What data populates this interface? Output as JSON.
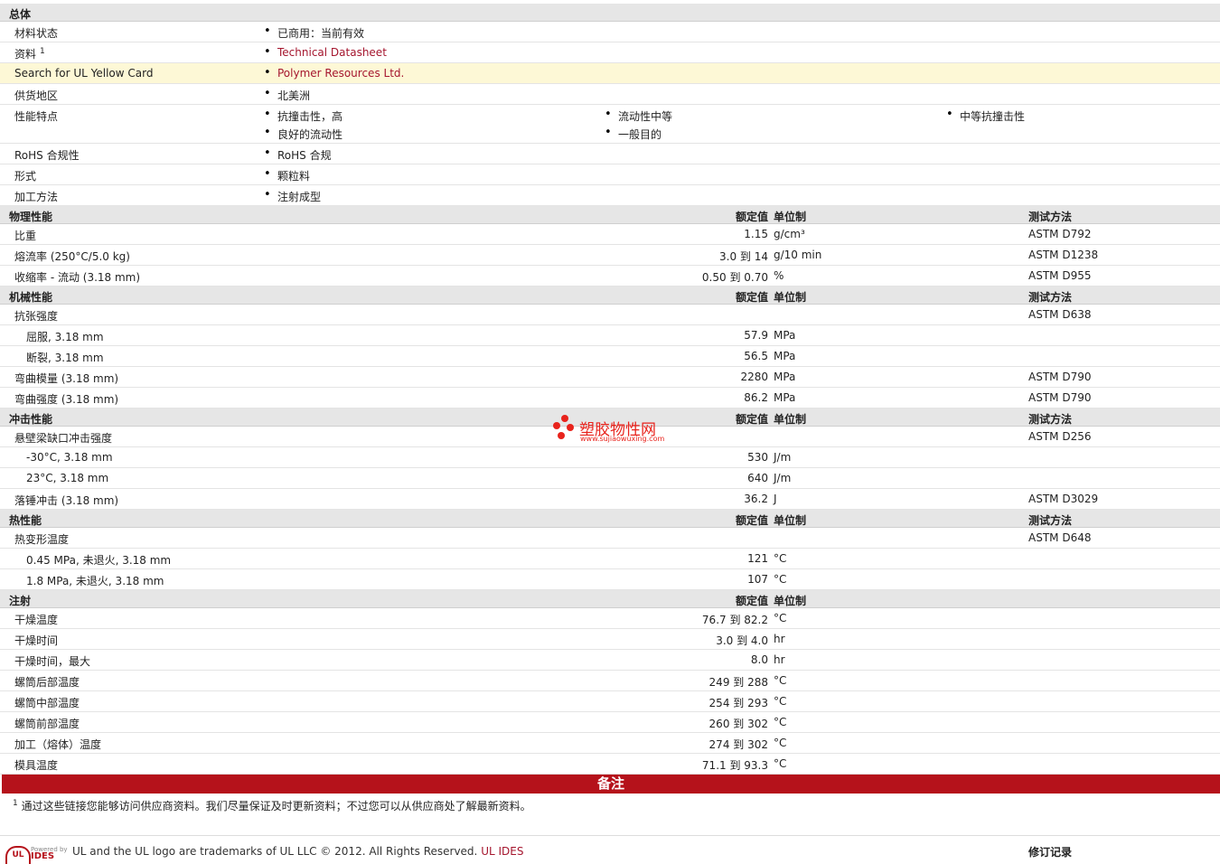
{
  "overview": {
    "title": "总体",
    "rows": [
      {
        "label": "材料状态",
        "bullets": [
          "已商用：当前有效"
        ]
      },
      {
        "label": "资料",
        "sup": "1",
        "bullets": [
          "Technical Datasheet"
        ],
        "link": true
      },
      {
        "label": "Search for UL Yellow Card",
        "bullets": [
          "Polymer Resources Ltd."
        ],
        "link": true,
        "highlight": true
      },
      {
        "label": "供货地区",
        "bullets": [
          "北美洲"
        ]
      },
      {
        "label": "性能特点",
        "cols": [
          [
            "抗撞击性，高",
            "良好的流动性"
          ],
          [
            "流动性中等",
            "一般目的"
          ],
          [
            "中等抗撞击性"
          ]
        ]
      },
      {
        "label": "RoHS 合规性",
        "bullets": [
          "RoHS 合规"
        ]
      },
      {
        "label": "形式",
        "bullets": [
          "颗粒料"
        ]
      },
      {
        "label": "加工方法",
        "bullets": [
          "注射成型"
        ]
      }
    ]
  },
  "headers": {
    "value": "额定值",
    "unit": "单位制",
    "method": "测试方法"
  },
  "sections": [
    {
      "title": "物理性能",
      "show_method": true,
      "rows": [
        {
          "label": "比重",
          "value": "1.15",
          "unit": "g/cm³",
          "method": "ASTM D792"
        },
        {
          "label": "熔流率  (250°C/5.0 kg)",
          "value": "3.0 到   14",
          "unit": "g/10 min",
          "method": "ASTM D1238"
        },
        {
          "label": "收缩率  - 流动  (3.18 mm)",
          "value": "0.50 到  0.70",
          "unit": "%",
          "method": "ASTM D955"
        }
      ]
    },
    {
      "title": "机械性能",
      "show_method": true,
      "rows": [
        {
          "label": "抗张强度",
          "value": "",
          "unit": "",
          "method": "ASTM D638"
        },
        {
          "label": "屈服, 3.18 mm",
          "sub": true,
          "value": "57.9",
          "unit": "MPa",
          "method": ""
        },
        {
          "label": "断裂, 3.18 mm",
          "sub": true,
          "value": "56.5",
          "unit": "MPa",
          "method": ""
        },
        {
          "label": "弯曲模量  (3.18 mm)",
          "value": "2280",
          "unit": "MPa",
          "method": "ASTM D790"
        },
        {
          "label": "弯曲强度  (3.18 mm)",
          "value": "86.2",
          "unit": "MPa",
          "method": "ASTM D790"
        }
      ]
    },
    {
      "title": "冲击性能",
      "show_method": true,
      "rows": [
        {
          "label": "悬壁梁缺口冲击强度",
          "value": "",
          "unit": "",
          "method": "ASTM D256"
        },
        {
          "label": "-30°C, 3.18 mm",
          "sub": true,
          "value": "530",
          "unit": "J/m",
          "method": ""
        },
        {
          "label": "23°C, 3.18 mm",
          "sub": true,
          "value": "640",
          "unit": "J/m",
          "method": ""
        },
        {
          "label": "落锤冲击  (3.18 mm)",
          "value": "36.2",
          "unit": "J",
          "method": "ASTM D3029"
        }
      ]
    },
    {
      "title": "热性能",
      "show_method": true,
      "rows": [
        {
          "label": "热变形温度",
          "value": "",
          "unit": "",
          "method": "ASTM D648"
        },
        {
          "label": "0.45 MPa, 未退火, 3.18 mm",
          "sub": true,
          "value": "121",
          "unit": "°C",
          "method": ""
        },
        {
          "label": "1.8 MPa, 未退火, 3.18 mm",
          "sub": true,
          "value": "107",
          "unit": "°C",
          "method": ""
        }
      ]
    },
    {
      "title": "注射",
      "show_method": false,
      "rows": [
        {
          "label": "干燥温度",
          "value": "76.7 到  82.2",
          "unit": "°C",
          "method": ""
        },
        {
          "label": "干燥时间",
          "value": "3.0 到   4.0",
          "unit": "hr",
          "method": ""
        },
        {
          "label": "干燥时间，最大",
          "value": "8.0",
          "unit": "hr",
          "method": ""
        },
        {
          "label": "螺筒后部温度",
          "value": "249 到  288",
          "unit": "°C",
          "method": ""
        },
        {
          "label": "螺筒中部温度",
          "value": "254 到  293",
          "unit": "°C",
          "method": ""
        },
        {
          "label": "螺筒前部温度",
          "value": "260 到  302",
          "unit": "°C",
          "method": ""
        },
        {
          "label": "加工（熔体）温度",
          "value": "274 到  302",
          "unit": "°C",
          "method": ""
        },
        {
          "label": "模具温度",
          "value": "71.1 到  93.3",
          "unit": "°C",
          "method": ""
        }
      ]
    }
  ],
  "notes": {
    "title": "备注",
    "footnote_num": "1",
    "footnote": "通过这些链接您能够访问供应商资料。我们尽量保证及时更新资料；不过您可以从供应商处了解最新资料。"
  },
  "footer": {
    "copyright": "UL and the UL logo are trademarks of UL LLC © 2012. All Rights Reserved.",
    "link": "UL IDES",
    "revision": "修订记录",
    "powered_by": "Powered by",
    "ides_logo": "IDES",
    "ul_logo": "UL"
  },
  "watermark": {
    "name": "塑胶物性网",
    "url": "www.sujiaowuxing.com"
  },
  "colors": {
    "accent": "#b5121b",
    "link": "#a5162e",
    "highlight": "#fdf8d6",
    "section_bg": "#e6e6e6"
  }
}
